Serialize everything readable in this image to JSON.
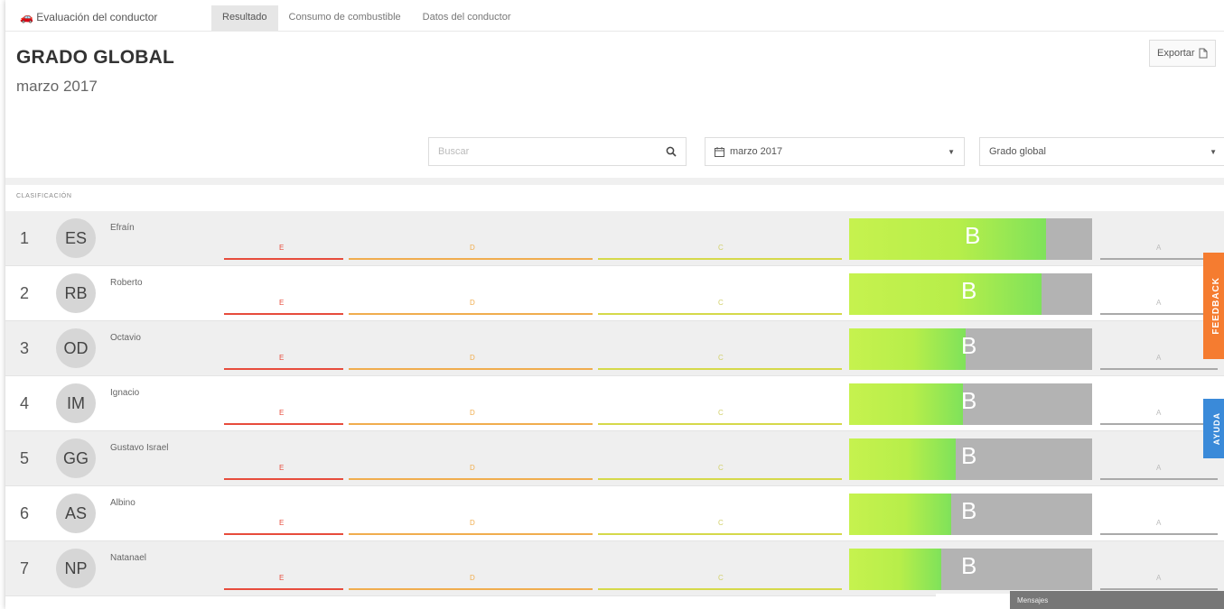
{
  "tabs": {
    "app_icon": "car-icon",
    "app_title": "Evaluación del conductor",
    "items": [
      {
        "label": "Resultado"
      },
      {
        "label": "Consumo de combustible"
      },
      {
        "label": "Datos del conductor"
      }
    ]
  },
  "header": {
    "title": "GRADO GLOBAL",
    "subtitle": "marzo 2017",
    "export_label": "Exportar"
  },
  "filters": {
    "search_placeholder": "Buscar",
    "date_value": "marzo 2017",
    "grade_value": "Grado global"
  },
  "section_label": "CLASIFICACIÓN",
  "segment_labels": {
    "e": "E",
    "d": "D",
    "c": "C",
    "a": "A"
  },
  "rows": [
    {
      "rank": "1",
      "initials": "ES",
      "name": "Efraín",
      "grade": "B",
      "score": 0.81
    },
    {
      "rank": "2",
      "initials": "RB",
      "name": "Roberto",
      "grade": "B",
      "score": 0.79
    },
    {
      "rank": "3",
      "initials": "OD",
      "name": "Octavio",
      "grade": "B",
      "score": 0.48
    },
    {
      "rank": "4",
      "initials": "IM",
      "name": "Ignacio",
      "grade": "B",
      "score": 0.47
    },
    {
      "rank": "5",
      "initials": "GG",
      "name": "Gustavo Israel",
      "grade": "B",
      "score": 0.44
    },
    {
      "rank": "6",
      "initials": "AS",
      "name": "Albino",
      "grade": "B",
      "score": 0.42
    },
    {
      "rank": "7",
      "initials": "NP",
      "name": "Natanael",
      "grade": "B",
      "score": 0.38
    }
  ],
  "side_tabs": {
    "feedback": "FEEDBACK",
    "help": "AYUDA"
  },
  "messages_label": "Mensajes",
  "colors": {
    "e": "#e74c3c",
    "d": "#f0ad4e",
    "c": "#d5d94a",
    "grade_fill": "#b7ee4a",
    "feedback": "#f57c30",
    "help": "#3a8ad9"
  }
}
